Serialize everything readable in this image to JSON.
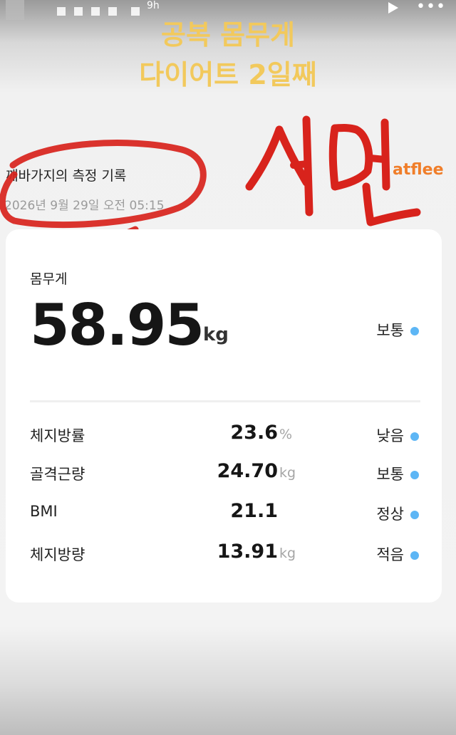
{
  "story": {
    "time": "9h"
  },
  "overlay": {
    "line1": "공복 몸무게",
    "line2": "다이어트 2일째",
    "handwriting": "서면"
  },
  "record": {
    "title": "깨바가지의 측정 기록",
    "datetime": "2026년 9월 29일 오전 05:15",
    "brand_partial": "atflee"
  },
  "weight": {
    "label": "몸무게",
    "value": "58.95",
    "unit": "kg",
    "status": "보통"
  },
  "metrics": [
    {
      "name": "체지방률",
      "value": "23.6",
      "unit": "%",
      "status": "낮음"
    },
    {
      "name": "골격근량",
      "value": "24.70",
      "unit": "kg",
      "status": "보통"
    },
    {
      "name": "BMI",
      "value": "21.1",
      "unit": "",
      "status": "정상"
    },
    {
      "name": "체지방량",
      "value": "13.91",
      "unit": "kg",
      "status": "적음"
    }
  ],
  "colors": {
    "status_dot": "#5db6f5",
    "overlay_text": "#f2c95c",
    "annotation": "#d8231c",
    "brand": "#f07e2a"
  }
}
